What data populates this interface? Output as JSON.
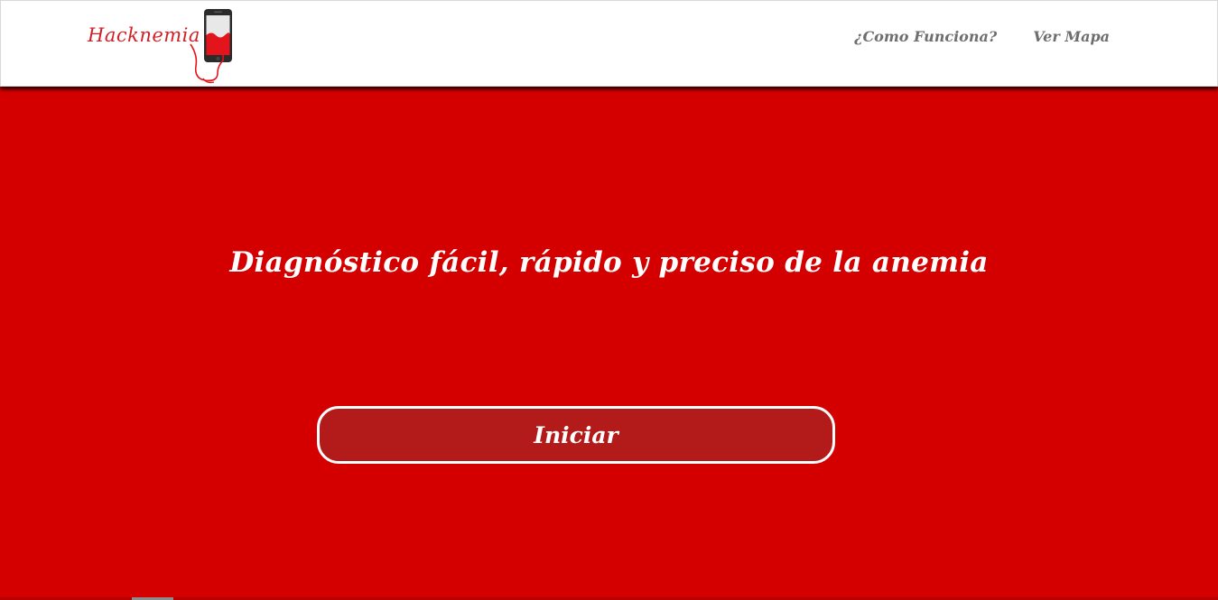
{
  "brand": {
    "name": "Hacknemia",
    "accent_color": "#d21f26"
  },
  "nav": {
    "items": [
      {
        "label": "¿Como Funciona?"
      },
      {
        "label": "Ver Mapa"
      }
    ]
  },
  "hero": {
    "headline": "Diagnóstico fácil, rápido y preciso de la anemia",
    "button_label": "Iniciar",
    "background_color": "#d40000",
    "button_color": "#b31b1b"
  },
  "icons": {
    "logo_icon": "phone-with-blood-drip-icon"
  }
}
